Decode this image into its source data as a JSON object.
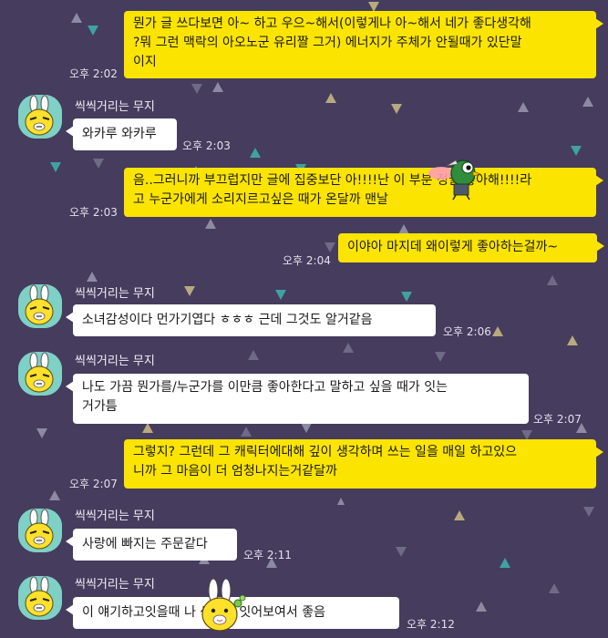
{
  "sender_name": "씩씩거리는 무지",
  "messages": [
    {
      "from": "me",
      "lines": [
        "뭔가 글 쓰다보면 아~ 하고 우으~해서(이렇게나 아~해서 네가 좋다생각해",
        "?뭐 그런 맥락의 아오노군 유리짤 그거) 에너지가 주체가 안될때가 있단말",
        "이지"
      ],
      "time": "오후 2:02"
    },
    {
      "from": "them",
      "lines": [
        "와카루 와카루"
      ],
      "time": "오후 2:03"
    },
    {
      "from": "me",
      "lines": [
        "음..그러니까 부끄럽지만 글에 집중보단 아!!!!난 이 부분 정말 좋아해!!!!라",
        "고 누군가에게 소리지르고싶은 때가 온달까 맨날"
      ],
      "time": "오후 2:03"
    },
    {
      "from": "me",
      "lines": [
        "이야아 마지데 왜이렇게 좋아하는걸까~"
      ],
      "time": "오후 2:04"
    },
    {
      "from": "them",
      "lines": [
        "소녀감성이다 먼가기엽다 ㅎㅎㅎ 근데 그것도 알거같음"
      ],
      "time": "오후 2:06"
    },
    {
      "from": "them",
      "lines": [
        "나도 가끔 뭔가를/누군가를 이만큼 좋아한다고 말하고 싶을 때가 잇는",
        "거가틈"
      ],
      "time": "오후 2:07"
    },
    {
      "from": "me",
      "lines": [
        "그렇지? 그런데 그 캐릭터에대해 깊이 생각하며 쓰는 일을 매일 하고있으",
        "니까 그 마음이 더 엄청나지는거같달까"
      ],
      "time": "오후 2:07"
    },
    {
      "from": "them",
      "lines": [
        "사랑에 빠지는 주문같다"
      ],
      "time": "오후 2:11"
    },
    {
      "from": "them",
      "lines": [
        "이 얘기하고잇을때 나 생기가 잇어보여서 좋음"
      ],
      "time": "오후 2:12"
    }
  ],
  "colors": {
    "background": "#453c5e",
    "my_bubble": "#fbe400",
    "their_bubble": "#ffffff",
    "avatar_bg": "#7fd0c5"
  },
  "icons": {
    "avatar": "muzi-avatar-icon",
    "sticker_1": "green-bird-character-sticker",
    "sticker_2": "muzi-character-sticker"
  }
}
